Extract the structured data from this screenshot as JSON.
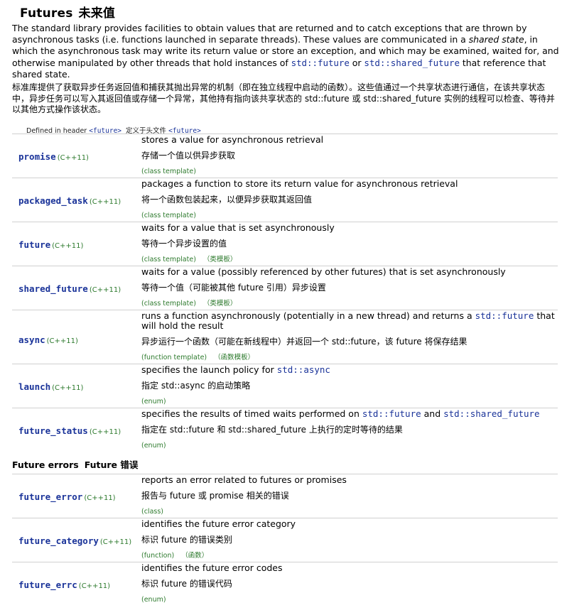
{
  "title": {
    "en": "Futures",
    "zh": "未来值"
  },
  "intro": {
    "en_a": "The standard library provides facilities to obtain values that are returned and to catch exceptions that are thrown by asynchronous tasks (i.e. functions launched in separate threads). These values are communicated in a ",
    "en_em": "shared state",
    "en_b": ", in which the asynchronous task may write its return value or store an exception, and which may be examined, waited for, and otherwise manipulated by other threads that hold instances of ",
    "code1": "std::future",
    "en_or": " or ",
    "code2": "std::shared_future",
    "en_c": " that reference that shared state.",
    "zh": "标准库提供了获取异步任务返回值和捕获其抛出异常的机制（即在独立线程中启动的函数）。这些值通过一个共享状态进行通信，在该共享状态中，异步任务可以写入其返回值或存储一个异常，其他持有指向该共享状态的 std::future 或 std::shared_future 实例的线程可以检查、等待并以其他方式操作该状态。"
  },
  "defined": {
    "label": "Defined in header",
    "header": "<future>",
    "zh_label": "定义于头文件",
    "zh_header": "<future>"
  },
  "items": [
    {
      "name": "promise",
      "version": "(C++11)",
      "desc": "stores a value for asynchronous retrieval",
      "zh": "存储一个值以供异步获取",
      "cat": "(class template)",
      "cat_zh": ""
    },
    {
      "name": "packaged_task",
      "version": "(C++11)",
      "desc": "packages a function to store its return value for asynchronous retrieval",
      "zh": "将一个函数包装起来，以便异步获取其返回值",
      "cat": "(class template)",
      "cat_zh": ""
    },
    {
      "name": "future",
      "version": "(C++11)",
      "desc": "waits for a value that is set asynchronously",
      "zh": "等待一个异步设置的值",
      "cat": "(class template)",
      "cat_zh": "（类模板）"
    },
    {
      "name": "shared_future",
      "version": "(C++11)",
      "desc": "waits for a value (possibly referenced by other futures) that is set asynchronously",
      "zh": "等待一个值（可能被其他 future 引用）异步设置",
      "cat": "(class template)",
      "cat_zh": "（类模板）"
    },
    {
      "name": "async",
      "version": "(C++11)",
      "desc_a": "runs a function asynchronously (potentially in a new thread) and returns a ",
      "desc_code": "std::future",
      "desc_b": " that will hold the result",
      "zh": "异步运行一个函数（可能在新线程中）并返回一个 std::future，该 future 将保存结果",
      "cat": "(function template)",
      "cat_zh": "（函数模板）"
    },
    {
      "name": "launch",
      "version": "(C++11)",
      "desc_a": "specifies the launch policy for ",
      "desc_code": "std::async",
      "zh": "指定 std::async 的启动策略",
      "cat": "(enum)",
      "cat_zh": ""
    },
    {
      "name": "future_status",
      "version": "(C++11)",
      "desc_a": "specifies the results of timed waits performed on ",
      "desc_code": "std::future",
      "desc_mid": " and ",
      "desc_code2": "std::shared_future",
      "zh": "指定在 std::future 和 std::shared_future 上执行的定时等待的结果",
      "cat": "(enum)",
      "cat_zh": ""
    }
  ],
  "errors_section": {
    "en": "Future errors",
    "zh": "Future 错误"
  },
  "errors": [
    {
      "name": "future_error",
      "version": "(C++11)",
      "desc": "reports an error related to futures or promises",
      "zh": "报告与 future 或 promise 相关的错误",
      "cat": "(class)",
      "cat_zh": ""
    },
    {
      "name": "future_category",
      "version": "(C++11)",
      "desc": "identifies the future error category",
      "zh": "标识 future 的错误类别",
      "cat": "(function)",
      "cat_zh": "（函数）"
    },
    {
      "name": "future_errc",
      "version": "(C++11)",
      "desc": "identifies the future error codes",
      "zh": "标识 future 的错误代码",
      "cat": "(enum)",
      "cat_zh": ""
    }
  ]
}
